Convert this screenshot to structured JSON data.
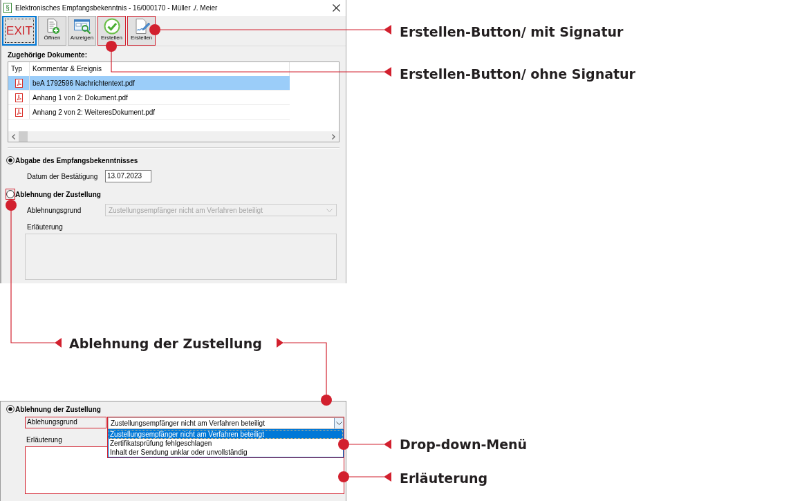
{
  "dialog": {
    "app_icon": "§",
    "title": "Elektronisches Empfangsbekenntnis - 16/000170 - Müller ./. Meier",
    "toolbar": [
      {
        "kind": "exit",
        "label": "EXIT",
        "focused": true,
        "highlighted": false
      },
      {
        "kind": "open",
        "label": "Öffnen",
        "focused": false,
        "highlighted": false
      },
      {
        "kind": "view",
        "label": "Anzeigen",
        "focused": false,
        "highlighted": false
      },
      {
        "kind": "create",
        "label": "Erstellen",
        "focused": false,
        "highlighted": true
      },
      {
        "kind": "sign",
        "label": "Erstellen",
        "focused": false,
        "highlighted": true
      }
    ],
    "documents": {
      "title": "Zugehörige Dokumente:",
      "columns": [
        "Typ",
        "Kommentar & Ereignis"
      ],
      "rows": [
        {
          "name": "beA 1792596 Nachrichtentext.pdf",
          "selected": true
        },
        {
          "name": "Anhang 1 von 2: Dokument.pdf",
          "selected": false
        },
        {
          "name": "Anhang 2 von 2: WeiteresDokument.pdf",
          "selected": false
        }
      ]
    },
    "options": [
      {
        "label": "Abgabe des Empfangsbekenntnisses",
        "selected": true,
        "highlighted": false,
        "fields": [
          {
            "kind": "date",
            "label": "Datum der Bestätigung",
            "value": "13.07.2023",
            "disabled": false
          }
        ]
      },
      {
        "label": "Ablehnung der Zustellung",
        "selected": false,
        "highlighted": true,
        "fields": [
          {
            "kind": "combo",
            "label": "Ablehnungsgrund",
            "value": "Zustellungsempfänger nicht am Verfahren beteiligt",
            "disabled": true
          },
          {
            "kind": "textarea",
            "label": "Erläuterung",
            "disabled": true
          }
        ]
      }
    ]
  },
  "detail": {
    "option": {
      "label": "Ablehnung der Zustellung",
      "selected": true
    },
    "fields": [
      {
        "kind": "combo",
        "label": "Ablehungsgrund",
        "label_highlighted": true,
        "value": "Zustellungsempfänger nicht am Verfahren beteiligt",
        "disabled": false,
        "expanded": true,
        "highlighted": true,
        "options": [
          {
            "label": "Zustellungsempfänger nicht am Verfahren beteiligt",
            "selected": true
          },
          {
            "label": "Zertifikatsprüfung fehlgeschlagen",
            "selected": false
          },
          {
            "label": "Inhalt der Sendung unklar oder unvollständig",
            "selected": false
          }
        ]
      },
      {
        "kind": "textarea",
        "label": "Erläuterung",
        "disabled": false,
        "highlighted": true
      }
    ]
  },
  "callouts": [
    {
      "label": "Erstellen-Button/ mit Signatur"
    },
    {
      "label": "Erstellen-Button/ ohne Signatur"
    },
    {
      "label": "Ablehnung der Zustellung"
    },
    {
      "label": "Drop-down-Menü"
    },
    {
      "label": "Erläuterung"
    }
  ]
}
